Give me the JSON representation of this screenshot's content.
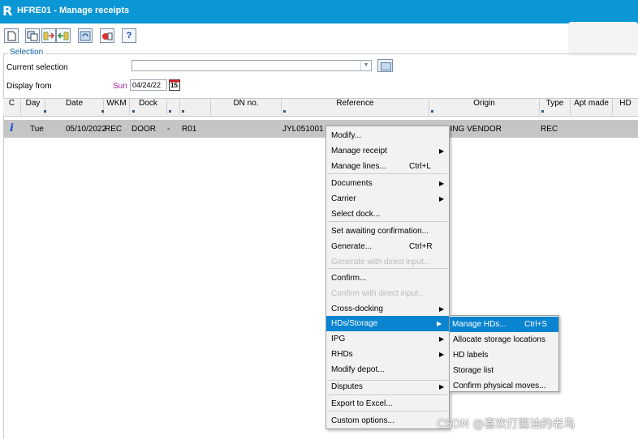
{
  "window": {
    "logo": "R",
    "title": "HFRE01 - Manage receipts"
  },
  "toolbar": {
    "icons": [
      "new-document-icon",
      "copy-icon",
      "transfer-icon",
      "import-icon",
      "refresh-icon",
      "print-icon",
      "help-icon"
    ],
    "help_label": "?"
  },
  "selection": {
    "group_label": "Selection",
    "current_selection_label": "Current selection",
    "current_selection_value": "",
    "display_from_label": "Display from",
    "day": "Sun",
    "date": "04/24/22",
    "calendar_day": "15"
  },
  "grid": {
    "headers": [
      "C",
      "Day",
      "Date",
      "WKM",
      "Dock",
      "",
      "",
      "DN no.",
      "Reference",
      "Origin",
      "Type",
      "Apt made",
      "HD"
    ],
    "row": {
      "status_icon": "i",
      "day": "Tue",
      "date": "05/10/2022",
      "wkm": "REC",
      "dock": "DOOR",
      "dash": "-",
      "door": "R01",
      "reference": "JYL051001",
      "origin": "TESTING VENDOR",
      "type": "REC"
    }
  },
  "context_menu": {
    "items": [
      {
        "label": "Modify...",
        "shortcut": "",
        "submenu": false,
        "disabled": false
      },
      {
        "label": "Manage receipt",
        "shortcut": "",
        "submenu": true,
        "disabled": false
      },
      {
        "label": "Manage lines...",
        "shortcut": "Ctrl+L",
        "submenu": false,
        "disabled": false
      },
      {
        "label": "Documents",
        "shortcut": "",
        "submenu": true,
        "disabled": false
      },
      {
        "label": "Carrier",
        "shortcut": "",
        "submenu": true,
        "disabled": false
      },
      {
        "label": "Select dock...",
        "shortcut": "",
        "submenu": false,
        "disabled": false
      },
      {
        "label": "Set awaiting confirmation...",
        "shortcut": "",
        "submenu": false,
        "disabled": false
      },
      {
        "label": "Generate...",
        "shortcut": "Ctrl+R",
        "submenu": false,
        "disabled": false
      },
      {
        "label": "Generate with direct input...",
        "shortcut": "",
        "submenu": false,
        "disabled": true
      },
      {
        "label": "Confirm...",
        "shortcut": "",
        "submenu": false,
        "disabled": false
      },
      {
        "label": "Confirm with direct input...",
        "shortcut": "",
        "submenu": false,
        "disabled": true
      },
      {
        "label": "Cross-docking",
        "shortcut": "",
        "submenu": true,
        "disabled": false
      },
      {
        "label": "HDs/Storage",
        "shortcut": "",
        "submenu": true,
        "disabled": false,
        "highlighted": true
      },
      {
        "label": "IPG",
        "shortcut": "",
        "submenu": true,
        "disabled": false
      },
      {
        "label": "RHDs",
        "shortcut": "",
        "submenu": true,
        "disabled": false
      },
      {
        "label": "Modify depot...",
        "shortcut": "",
        "submenu": false,
        "disabled": false
      },
      {
        "label": "Disputes",
        "shortcut": "",
        "submenu": true,
        "disabled": false
      },
      {
        "label": "Export to Excel...",
        "shortcut": "",
        "submenu": false,
        "disabled": false
      },
      {
        "label": "Custom options...",
        "shortcut": "",
        "submenu": false,
        "disabled": false
      }
    ]
  },
  "submenu": {
    "items": [
      {
        "label": "Manage HDs...",
        "shortcut": "Ctrl+S",
        "highlighted": true
      },
      {
        "label": "Allocate storage locations",
        "shortcut": ""
      },
      {
        "label": "HD labels",
        "shortcut": ""
      },
      {
        "label": "Storage list",
        "shortcut": ""
      },
      {
        "label": "Confirm physical moves...",
        "shortcut": ""
      }
    ]
  },
  "watermark": "CSDN @喜欢打酱油的老鸟",
  "colors": {
    "titlebar": "#0b96d6",
    "highlight": "#0a84d0",
    "row_selected": "#c5c5c5"
  }
}
